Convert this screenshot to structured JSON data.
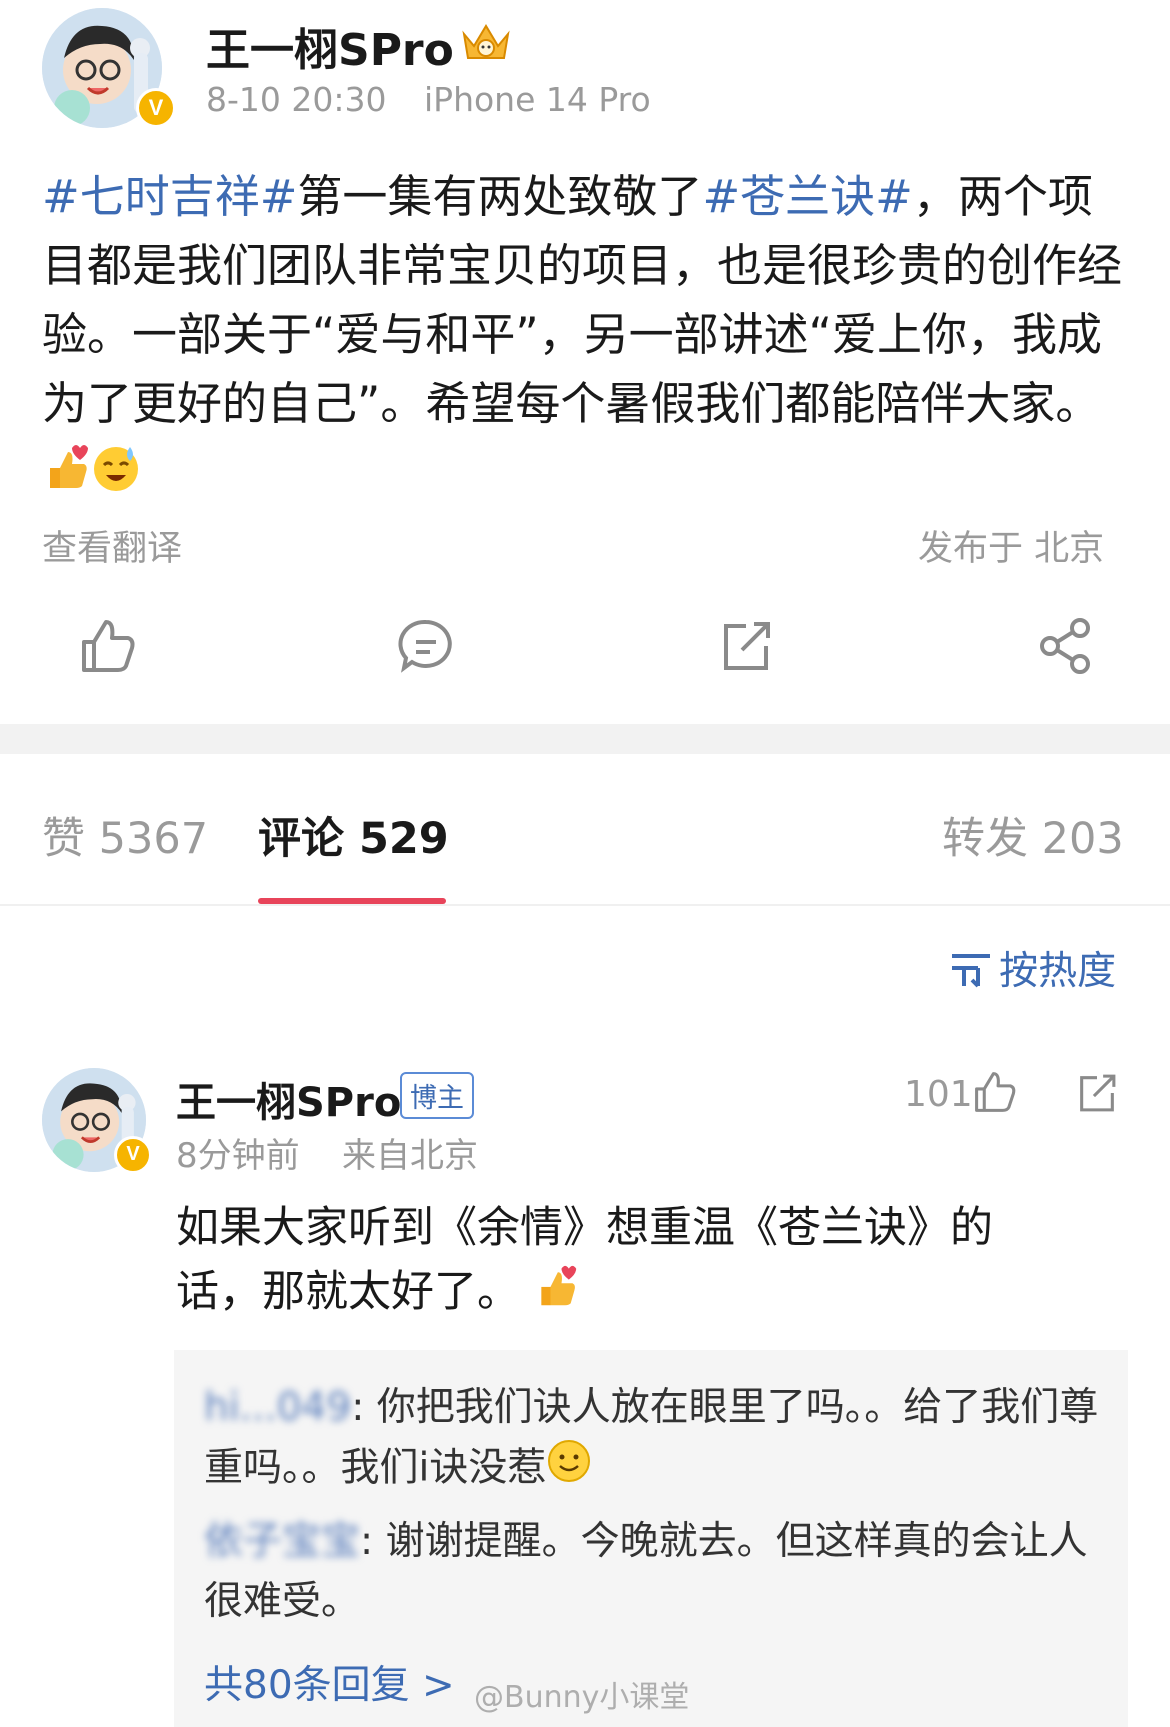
{
  "post": {
    "author": "王一栩SPro",
    "time": "8-10 20:30",
    "device": "iPhone 14 Pro",
    "text": {
      "topic1": "#七时吉祥#",
      "part1": "第一集有两处致敬了",
      "topic2": "#苍兰诀#",
      "part2": "，两个项目都是我们团队非常宝贝的项目，也是很珍贵的创作经验。一部关于“爱与和平”，另一部讲述“爱上你，我成为了更好的自己”。希望每个暑假我们都能陪伴大家。"
    },
    "translate_label": "查看翻译",
    "location_label": "发布于 北京"
  },
  "tabs": {
    "likes": "赞 5367",
    "comments": "评论 529",
    "reposts": "转发 203"
  },
  "sort_label": "按热度",
  "comment": {
    "author": "王一栩SPro",
    "badge": "博主",
    "time": "8分钟前",
    "location": "来自北京",
    "likes": "101",
    "text": "如果大家听到《余情》想重温《苍兰诀》的话，那就太好了。",
    "replies": [
      {
        "user": "hi...049",
        "text": "你把我们诀人放在眼里了吗。。给了我们尊重吗。。我们i诀没惹"
      },
      {
        "user": "依子宝宝",
        "text": "谢谢提醒。今晚就去。但这样真的会让人很难受。"
      }
    ],
    "more_replies": "共80条回复 >",
    "watermark": "@Bunny小课堂"
  },
  "colors": {
    "topic": "#3d6bb3",
    "accent": "#e8445a",
    "gray": "#9a9a9a",
    "badge": "#f6b400"
  }
}
